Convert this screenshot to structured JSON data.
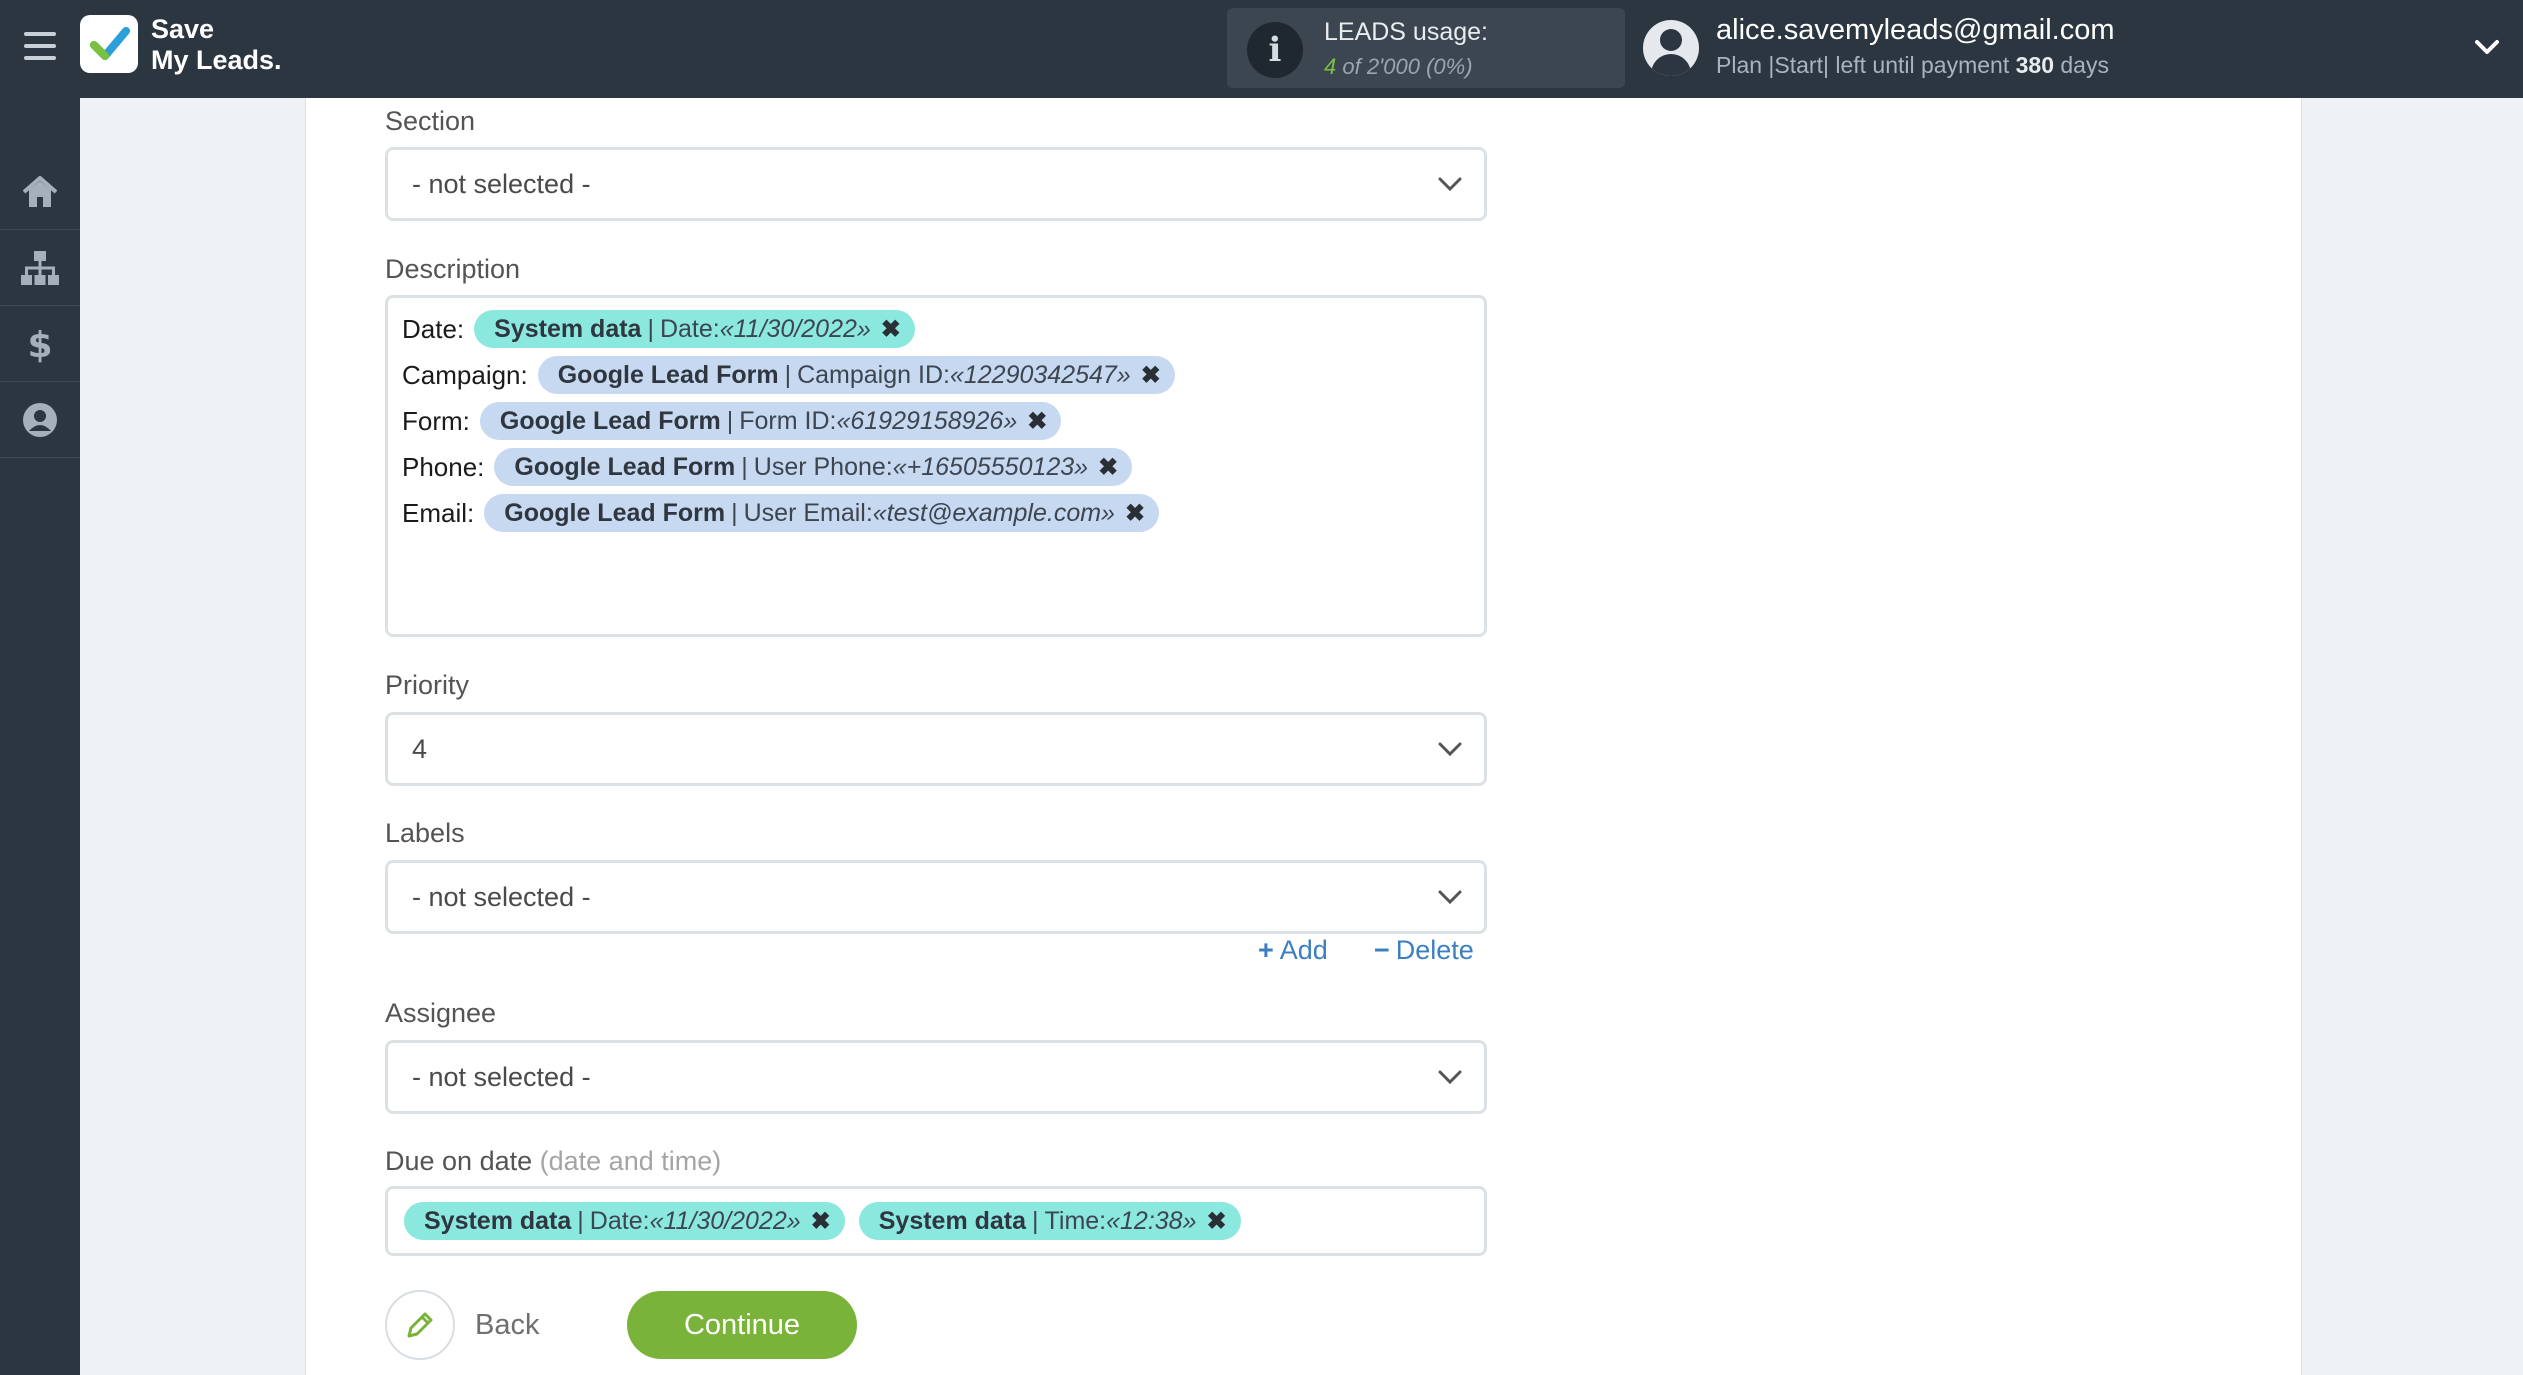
{
  "app": {
    "logo_line1": "Save",
    "logo_line2": "My Leads."
  },
  "usage": {
    "title": "LEADS usage:",
    "used": "4",
    "total": " of 2'000",
    "percent": " (0%)"
  },
  "account": {
    "email": "alice.savemyleads@gmail.com",
    "plan_prefix": "Plan |Start| left until payment ",
    "days": "380",
    "days_suffix": " days"
  },
  "icons": {
    "menu": "hamburger-icon",
    "home": "home-icon",
    "integrations": "sitemap-icon",
    "billing": "dollar-icon",
    "profile": "user-icon",
    "info": "info-icon",
    "chevron": "chevron-down-icon",
    "add": "plus-icon",
    "delete": "minus-icon",
    "back": "pencil-icon",
    "remove": "close-icon"
  },
  "colors": {
    "topbar": "#2c3641",
    "accent_green": "#79b33a",
    "link_blue": "#3b7fc1",
    "tag_system": "#8be8df",
    "tag_source": "#c7d9f0"
  },
  "form": {
    "section": {
      "label": "Section",
      "value": "- not selected -"
    },
    "description": {
      "label": "Description",
      "rows": [
        {
          "label": "Date:",
          "source": "System data",
          "field": "Date: ",
          "value": "«11/30/2022»"
        },
        {
          "label": "Campaign:",
          "source": "Google Lead Form",
          "field": "Campaign ID: ",
          "value": "«12290342547»"
        },
        {
          "label": "Form:",
          "source": "Google Lead Form",
          "field": "Form ID: ",
          "value": "«61929158926»"
        },
        {
          "label": "Phone:",
          "source": "Google Lead Form",
          "field": "User Phone: ",
          "value": "«+16505550123»"
        },
        {
          "label": "Email:",
          "source": "Google Lead Form",
          "field": "User Email: ",
          "value": "«test@example.com»"
        }
      ]
    },
    "priority": {
      "label": "Priority",
      "value": "4"
    },
    "labels": {
      "label": "Labels",
      "value": "- not selected -",
      "add": "Add",
      "delete": "Delete"
    },
    "assignee": {
      "label": "Assignee",
      "value": "- not selected -"
    },
    "due": {
      "label": "Due on date",
      "hint": "(date and time)",
      "tags": [
        {
          "source": "System data",
          "field": "Date: ",
          "value": "«11/30/2022»"
        },
        {
          "source": "System data",
          "field": "Time: ",
          "value": "«12:38»"
        }
      ]
    }
  },
  "actions": {
    "back": "Back",
    "continue": "Continue"
  }
}
